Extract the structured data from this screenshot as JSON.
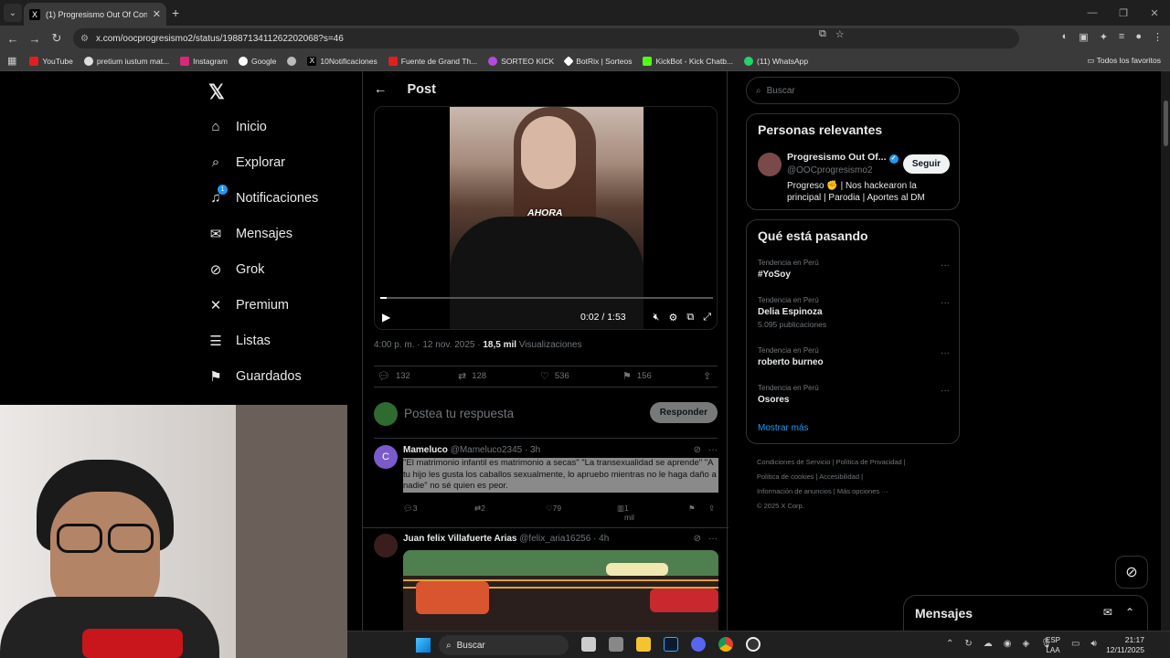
{
  "browser": {
    "tab_title": "(1) Progresismo Out Of Context",
    "url": "x.com/oocprogresismo2/status/1988713411262202068?s=46",
    "bookmarks": [
      "YouTube",
      "pretium iustum mat...",
      "Instagram",
      "Google",
      "",
      "10Notificaciones",
      "Fuente de Grand Th...",
      "SORTEO KICK",
      "BotRix | Sorteos",
      "KickBot - Kick Chatb...",
      "(11) WhatsApp"
    ],
    "all_bookmarks": "Todos los favoritos"
  },
  "nav": {
    "items": [
      "Inicio",
      "Explorar",
      "Notificaciones",
      "Mensajes",
      "Grok",
      "Premium",
      "Listas",
      "Guardados"
    ],
    "notif_badge": "1"
  },
  "post": {
    "header": "Post",
    "video_caption": "AHORA",
    "video_time": "0:02 / 1:53",
    "video_progress": 0.018,
    "meta_time": "4:00 p. m. · 12 nov. 2025 · ",
    "meta_views": "18,5 mil",
    "meta_views_label": " Visualizaciones",
    "replies": "132",
    "reposts": "128",
    "likes": "536",
    "bookmarks": "156",
    "reply_placeholder": "Postea tu respuesta",
    "reply_button": "Responder"
  },
  "tweets": [
    {
      "avatar_letter": "C",
      "name": "Mameluco",
      "handle": "@Mameluco2345 · 3h",
      "text": "\"El matrimonio infantil es matrimonio a secas\" \"La transexualidad se aprende\" \"A tu hijo les gusta los caballos sexualmente, lo apruebo mientras no le haga daño a nadie\" no sé quien es peor.",
      "replies": "3",
      "reposts": "2",
      "likes": "79",
      "views": "1 mil"
    },
    {
      "name": "Juan felix Villafuerte Arias",
      "handle": "@felix_aria16256 · 4h"
    }
  ],
  "sidebar": {
    "search_placeholder": "Buscar",
    "relevant_title": "Personas relevantes",
    "person_name": "Progresismo Out Of...",
    "person_handle": "@OOCprogresismo2",
    "follow_label": "Seguir",
    "person_bio": "Progreso ✊ | Nos hackearon la principal | Parodia | Aportes al DM",
    "trending_title": "Qué está pasando",
    "trends": [
      {
        "category": "Tendencia en Perú",
        "name": "#YoSoy",
        "count": ""
      },
      {
        "category": "Tendencia en Perú",
        "name": "Delia Espinoza",
        "count": "5.095 publicaciones"
      },
      {
        "category": "Tendencia en Perú",
        "name": "roberto burneo",
        "count": ""
      },
      {
        "category": "Tendencia en Perú",
        "name": "Osores",
        "count": ""
      }
    ],
    "show_more": "Mostrar más",
    "footer": [
      "Condiciones de Servicio",
      "Política de Privacidad",
      "Política de cookies",
      "Accesibilidad",
      "Información de anuncios",
      "Más opciones ···",
      "© 2025 X Corp."
    ]
  },
  "messages_drawer": "Mensajes",
  "taskbar": {
    "search": "Buscar",
    "lang1": "ESP",
    "lang2": "LAA",
    "time": "21:17",
    "date": "12/11/2025"
  }
}
